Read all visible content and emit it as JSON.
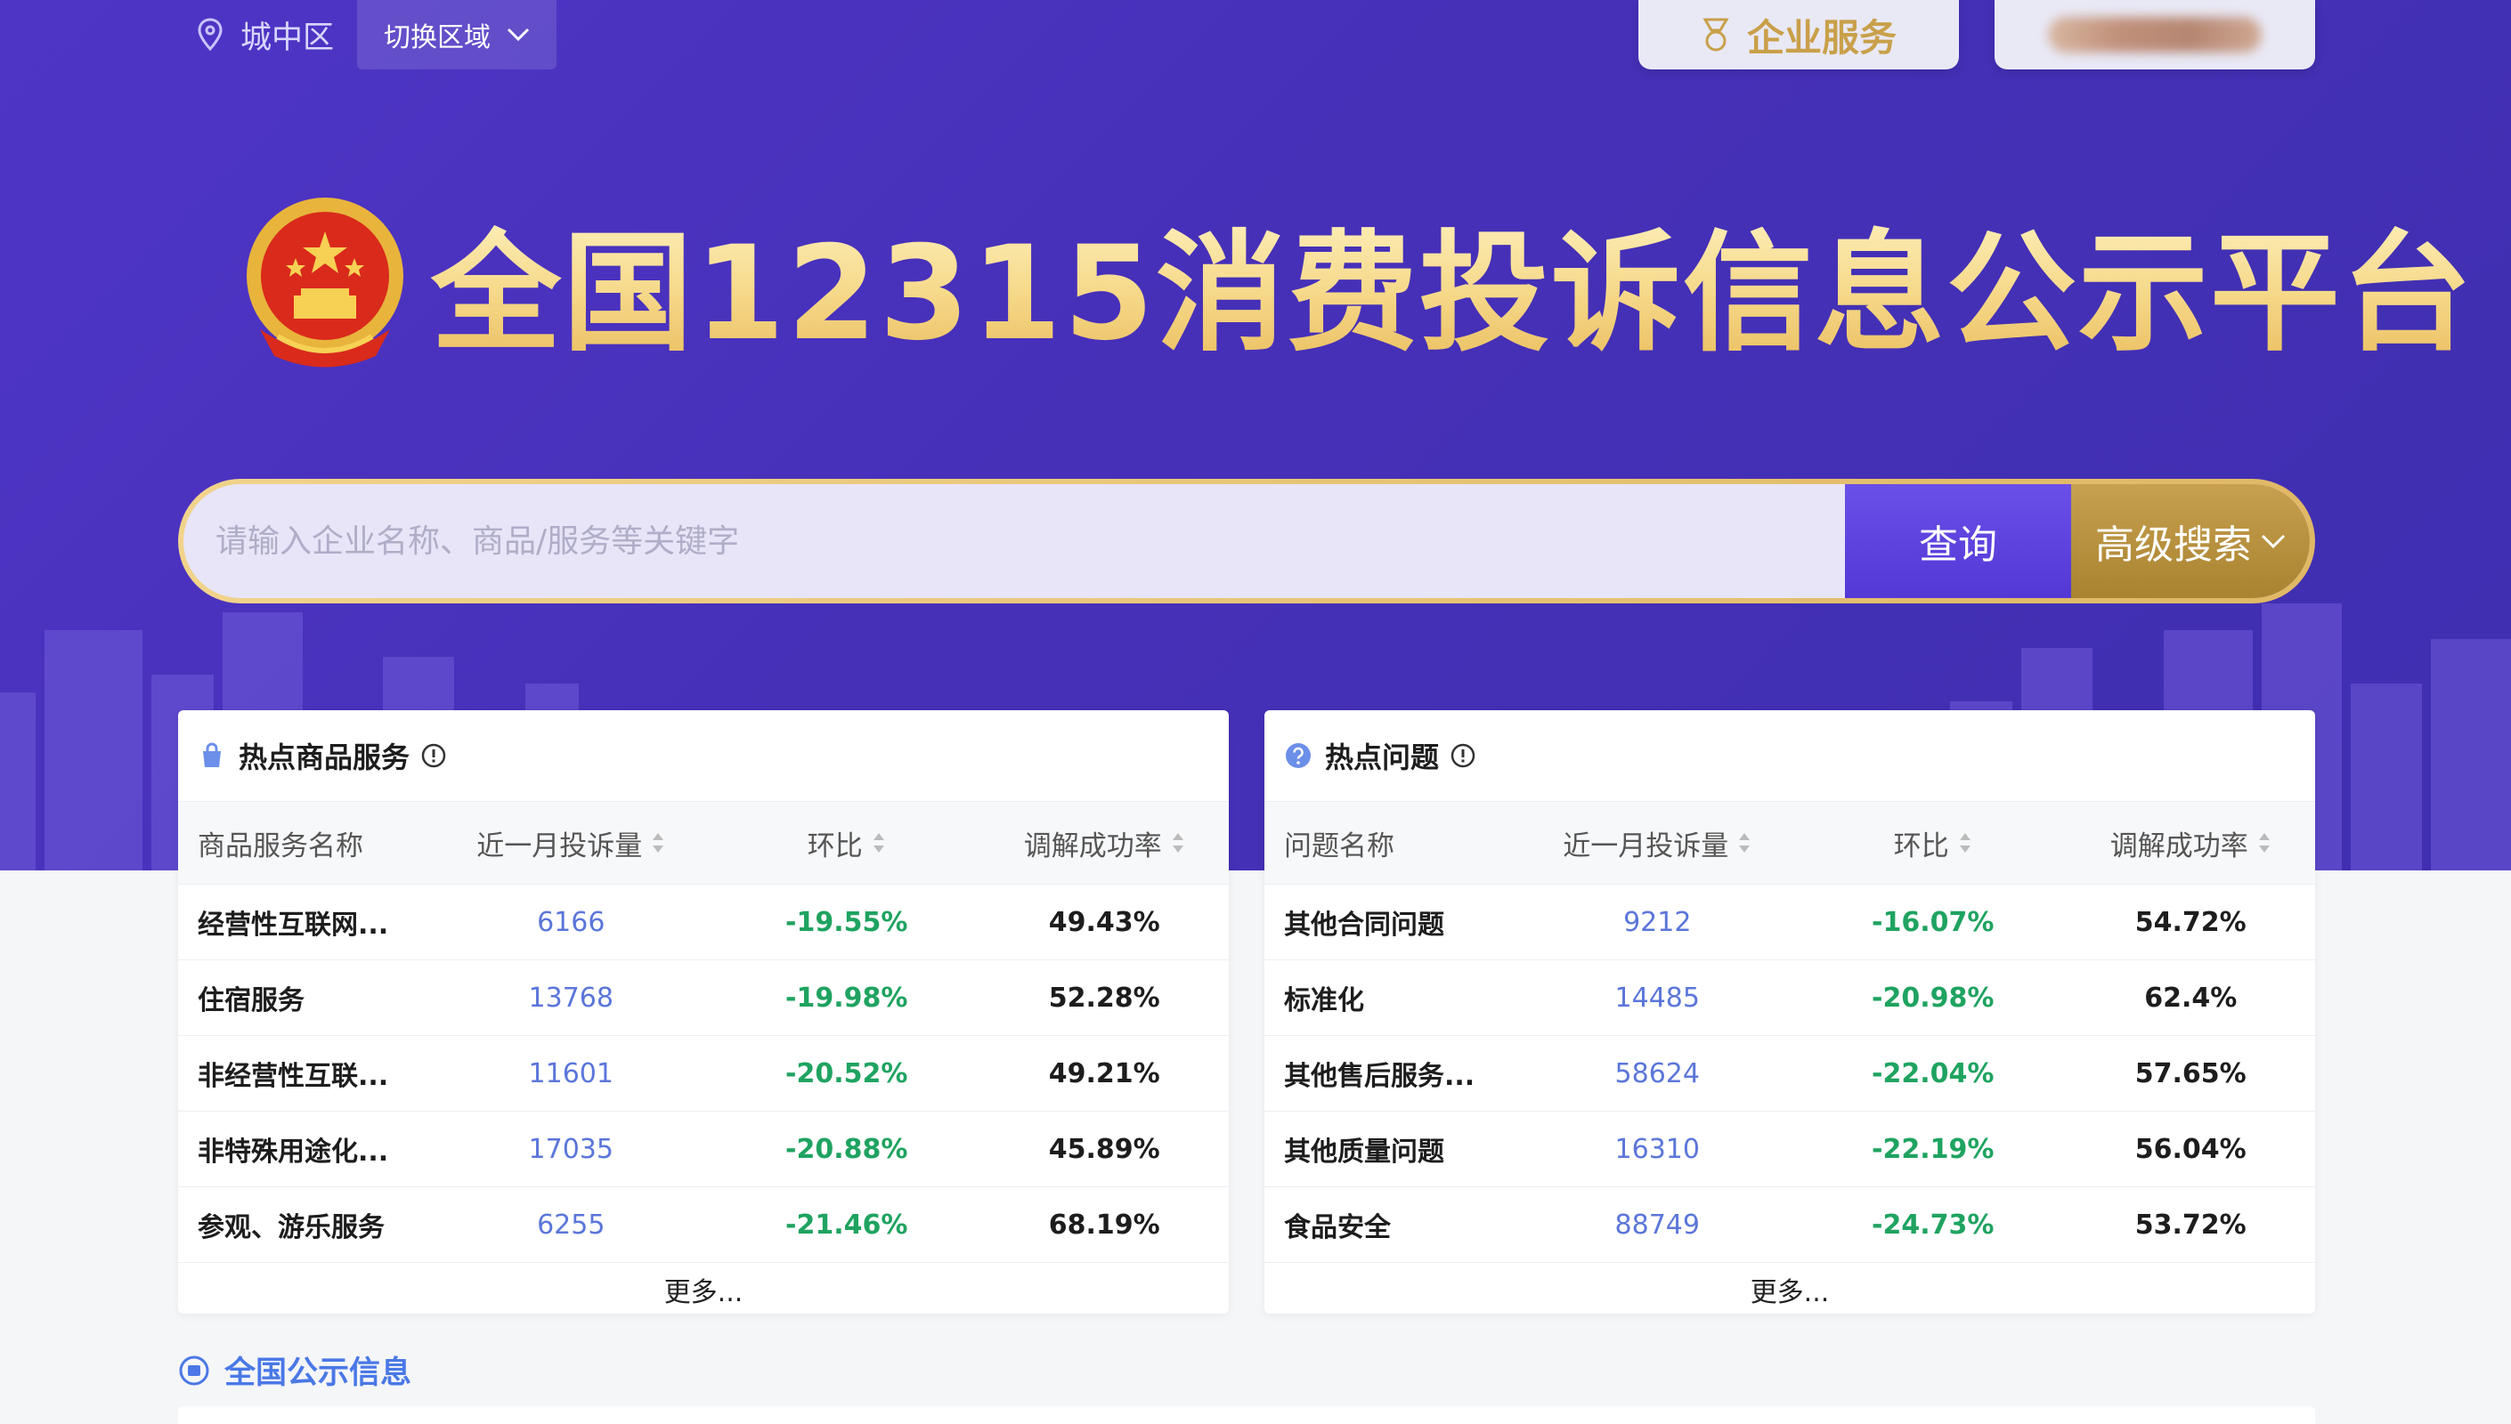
{
  "topbar": {
    "region": "城中区",
    "switch_label": "切换区域",
    "enterprise_label": "企业服务"
  },
  "title": "全国12315消费投诉信息公示平台",
  "search": {
    "placeholder": "请输入企业名称、商品/服务等关键字",
    "query_label": "查询",
    "advanced_label": "高级搜索"
  },
  "hot_goods": {
    "title": "热点商品服务",
    "headers": [
      "商品服务名称",
      "近一月投诉量",
      "环比",
      "调解成功率"
    ],
    "rows": [
      {
        "name": "经营性互联网...",
        "count": "6166",
        "ratio": "-19.55%",
        "rate": "49.43%"
      },
      {
        "name": "住宿服务",
        "count": "13768",
        "ratio": "-19.98%",
        "rate": "52.28%"
      },
      {
        "name": "非经营性互联...",
        "count": "11601",
        "ratio": "-20.52%",
        "rate": "49.21%"
      },
      {
        "name": "非特殊用途化...",
        "count": "17035",
        "ratio": "-20.88%",
        "rate": "45.89%"
      },
      {
        "name": "参观、游乐服务",
        "count": "6255",
        "ratio": "-21.46%",
        "rate": "68.19%"
      }
    ],
    "more": "更多..."
  },
  "hot_issues": {
    "title": "热点问题",
    "headers": [
      "问题名称",
      "近一月投诉量",
      "环比",
      "调解成功率"
    ],
    "rows": [
      {
        "name": "其他合同问题",
        "count": "9212",
        "ratio": "-16.07%",
        "rate": "54.72%"
      },
      {
        "name": "标准化",
        "count": "14485",
        "ratio": "-20.98%",
        "rate": "62.4%"
      },
      {
        "name": "其他售后服务...",
        "count": "58624",
        "ratio": "-22.04%",
        "rate": "57.65%"
      },
      {
        "name": "其他质量问题",
        "count": "16310",
        "ratio": "-22.19%",
        "rate": "56.04%"
      },
      {
        "name": "食品安全",
        "count": "88749",
        "ratio": "-24.73%",
        "rate": "53.72%"
      }
    ],
    "more": "更多..."
  },
  "section": {
    "title": "全国公示信息"
  },
  "colors": {
    "hero_bg": "#4a33c0",
    "gold": "#e9bb5b",
    "positive_blue": "#5b76d9",
    "ratio_green": "#1fa360",
    "section_blue": "#4a78e6"
  }
}
